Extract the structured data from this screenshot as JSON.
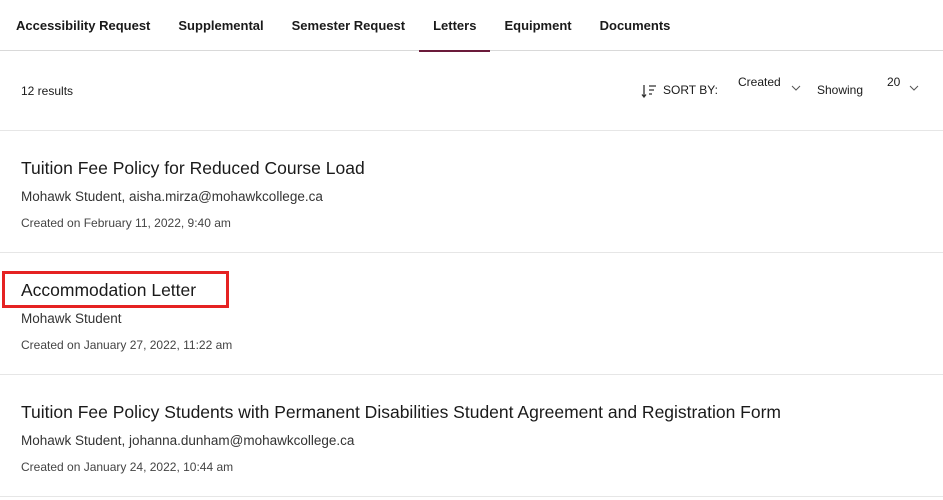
{
  "tabs": [
    {
      "label": "Accessibility Request"
    },
    {
      "label": "Supplemental"
    },
    {
      "label": "Semester Request"
    },
    {
      "label": "Letters"
    },
    {
      "label": "Equipment"
    },
    {
      "label": "Documents"
    }
  ],
  "active_tab": "Letters",
  "toolbar": {
    "results_count": "12 results",
    "sort_label": "SORT BY:",
    "sort_value": "Created",
    "showing_label": "Showing",
    "showing_value": "20"
  },
  "items": [
    {
      "title": "Tuition Fee Policy for Reduced Course Load",
      "subtitle": "Mohawk Student, aisha.mirza@mohawkcollege.ca",
      "date": "Created on February 11, 2022, 9:40 am"
    },
    {
      "title": "Accommodation Letter",
      "subtitle": "Mohawk Student",
      "date": "Created on January 27, 2022, 11:22 am"
    },
    {
      "title": "Tuition Fee Policy Students with Permanent Disabilities Student Agreement and Registration Form",
      "subtitle": "Mohawk Student, johanna.dunham@mohawkcollege.ca",
      "date": "Created on January 24, 2022, 10:44 am"
    }
  ],
  "colors": {
    "accent": "#6b1a3a",
    "highlight": "#e52222"
  }
}
